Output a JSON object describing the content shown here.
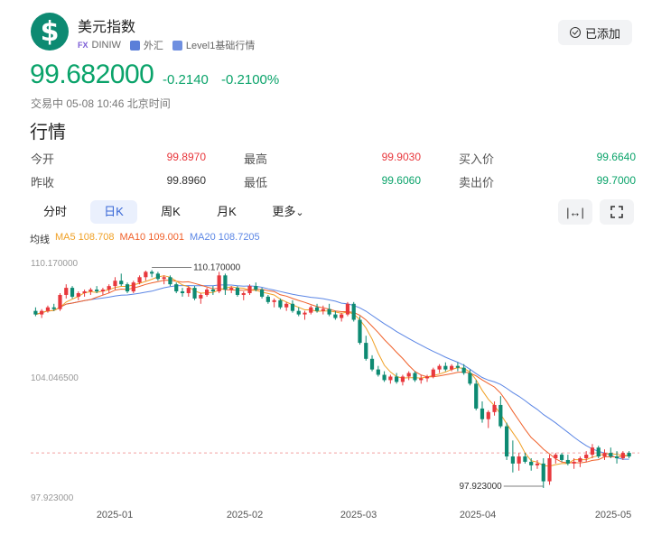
{
  "header": {
    "name": "美元指数",
    "fx_tag": "FX",
    "code": "DINIW",
    "tag_forex": "外汇",
    "tag_level": "Level1基础行情",
    "added_label": "已添加",
    "icon_name": "dollar-icon"
  },
  "price": {
    "last": "99.682000",
    "change": "-0.2140",
    "change_pct": "-0.2100%",
    "status": "交易中 05-08 10:46 北京时间"
  },
  "section_title": "行情",
  "quote": {
    "open_label": "今开",
    "open": "99.8970",
    "high_label": "最高",
    "high": "99.9030",
    "bid_label": "买入价",
    "bid": "99.6640",
    "prev_label": "昨收",
    "prev": "99.8960",
    "low_label": "最低",
    "low": "99.6060",
    "ask_label": "卖出价",
    "ask": "99.7000"
  },
  "tabs": [
    {
      "label": "分时"
    },
    {
      "label": "日K"
    },
    {
      "label": "周K"
    },
    {
      "label": "月K"
    },
    {
      "label": "更多"
    }
  ],
  "tools": {
    "fit_icon": "fit-width-icon",
    "fullscreen_icon": "fullscreen-icon"
  },
  "legend": {
    "title": "均线",
    "ma5": "MA5 108.708",
    "ma10": "MA10 109.001",
    "ma20": "MA20 108.7205"
  },
  "colors": {
    "up": "#e8383d",
    "down": "#0d8a72",
    "ma5": "#f0a025",
    "ma10": "#f0602a",
    "ma20": "#5b86e5",
    "accent": "#0aa36a"
  },
  "chart_data": {
    "type": "candlestick",
    "yaxis_ticks": [
      "110.170000",
      "104.046500",
      "97.923000"
    ],
    "x_labels": [
      "2025-01",
      "2025-02",
      "2025-03",
      "2025-04",
      "2025-05"
    ],
    "ylim": [
      97.923,
      110.17
    ],
    "high_annotation": "110.170000",
    "low_annotation": "97.923000",
    "prev_close": 99.896,
    "ohlc": [
      [
        107.9,
        108.1,
        107.6,
        107.7
      ],
      [
        107.7,
        108.0,
        107.5,
        107.9
      ],
      [
        107.9,
        108.2,
        107.8,
        108.1
      ],
      [
        108.1,
        108.3,
        107.9,
        108.0
      ],
      [
        108.0,
        108.9,
        107.9,
        108.8
      ],
      [
        108.8,
        109.4,
        108.6,
        109.2
      ],
      [
        109.2,
        109.3,
        108.6,
        108.7
      ],
      [
        108.7,
        109.0,
        108.5,
        108.9
      ],
      [
        108.9,
        109.1,
        108.7,
        109.0
      ],
      [
        109.0,
        109.2,
        108.8,
        109.1
      ],
      [
        109.1,
        109.3,
        108.9,
        109.0
      ],
      [
        109.0,
        109.2,
        108.8,
        109.1
      ],
      [
        109.1,
        109.4,
        108.9,
        109.3
      ],
      [
        109.3,
        109.8,
        109.1,
        109.6
      ],
      [
        109.6,
        110.0,
        109.3,
        109.4
      ],
      [
        109.4,
        109.5,
        108.9,
        109.0
      ],
      [
        109.0,
        109.6,
        108.9,
        109.5
      ],
      [
        109.5,
        109.9,
        109.4,
        109.8
      ],
      [
        109.8,
        110.17,
        109.6,
        110.1
      ],
      [
        110.1,
        110.2,
        109.8,
        110.0
      ],
      [
        110.0,
        110.1,
        109.6,
        109.7
      ],
      [
        109.7,
        109.9,
        109.4,
        109.8
      ],
      [
        109.8,
        109.9,
        109.3,
        109.4
      ],
      [
        109.4,
        109.5,
        108.9,
        109.0
      ],
      [
        109.0,
        109.2,
        108.7,
        108.9
      ],
      [
        108.9,
        109.3,
        108.7,
        109.2
      ],
      [
        109.2,
        109.3,
        108.5,
        108.6
      ],
      [
        108.6,
        108.9,
        108.3,
        108.8
      ],
      [
        108.8,
        109.2,
        108.7,
        109.1
      ],
      [
        109.1,
        109.3,
        108.8,
        109.0
      ],
      [
        109.0,
        110.1,
        108.9,
        109.9
      ],
      [
        109.9,
        110.0,
        108.8,
        109.1
      ],
      [
        109.1,
        109.3,
        108.9,
        109.2
      ],
      [
        109.2,
        109.3,
        108.7,
        108.8
      ],
      [
        108.8,
        109.0,
        108.5,
        108.9
      ],
      [
        108.9,
        109.4,
        108.8,
        109.3
      ],
      [
        109.3,
        109.5,
        109.0,
        109.1
      ],
      [
        109.1,
        109.2,
        108.6,
        108.7
      ],
      [
        108.7,
        108.8,
        108.3,
        108.4
      ],
      [
        108.4,
        108.6,
        108.1,
        108.5
      ],
      [
        108.5,
        108.6,
        108.0,
        108.1
      ],
      [
        108.1,
        108.4,
        107.9,
        108.3
      ],
      [
        108.3,
        108.5,
        107.8,
        107.9
      ],
      [
        107.9,
        108.1,
        107.6,
        107.7
      ],
      [
        107.7,
        107.9,
        107.4,
        107.8
      ],
      [
        107.8,
        108.2,
        107.7,
        108.1
      ],
      [
        108.1,
        108.3,
        107.8,
        107.9
      ],
      [
        107.9,
        108.2,
        107.7,
        108.0
      ],
      [
        108.0,
        108.3,
        107.6,
        107.7
      ],
      [
        107.7,
        107.9,
        107.4,
        107.5
      ],
      [
        107.5,
        107.8,
        107.3,
        107.7
      ],
      [
        107.7,
        108.4,
        107.6,
        108.3
      ],
      [
        108.3,
        108.4,
        107.3,
        107.4
      ],
      [
        107.4,
        107.6,
        106.0,
        106.1
      ],
      [
        106.1,
        106.5,
        105.1,
        105.2
      ],
      [
        105.2,
        105.4,
        104.5,
        104.6
      ],
      [
        104.6,
        104.8,
        104.2,
        104.3
      ],
      [
        104.3,
        104.5,
        103.9,
        104.0
      ],
      [
        104.0,
        104.3,
        103.8,
        104.2
      ],
      [
        104.2,
        104.4,
        103.8,
        103.9
      ],
      [
        103.9,
        104.3,
        103.7,
        104.2
      ],
      [
        104.2,
        104.5,
        104.0,
        104.4
      ],
      [
        104.4,
        104.5,
        103.9,
        104.0
      ],
      [
        104.0,
        104.3,
        103.8,
        104.1
      ],
      [
        104.1,
        104.3,
        103.9,
        104.2
      ],
      [
        104.2,
        104.7,
        104.1,
        104.6
      ],
      [
        104.6,
        104.9,
        104.4,
        104.8
      ],
      [
        104.8,
        105.0,
        104.5,
        104.6
      ],
      [
        104.6,
        104.9,
        104.5,
        104.8
      ],
      [
        104.8,
        105.0,
        104.5,
        104.7
      ],
      [
        104.7,
        104.9,
        104.3,
        104.4
      ],
      [
        104.4,
        104.6,
        103.7,
        103.8
      ],
      [
        103.8,
        104.0,
        102.3,
        102.4
      ],
      [
        102.4,
        102.8,
        101.6,
        101.8
      ],
      [
        101.8,
        102.3,
        101.3,
        102.2
      ],
      [
        102.2,
        102.8,
        102.0,
        102.6
      ],
      [
        102.6,
        103.1,
        101.3,
        101.4
      ],
      [
        101.4,
        101.6,
        99.5,
        99.7
      ],
      [
        99.7,
        100.6,
        98.8,
        99.3
      ],
      [
        99.3,
        99.9,
        98.9,
        99.7
      ],
      [
        99.7,
        99.9,
        99.3,
        99.4
      ],
      [
        99.4,
        99.6,
        98.9,
        99.2
      ],
      [
        99.2,
        99.5,
        99.0,
        99.3
      ],
      [
        99.3,
        99.6,
        97.923,
        98.3
      ],
      [
        98.3,
        99.8,
        98.1,
        99.6
      ],
      [
        99.6,
        99.9,
        99.3,
        99.8
      ],
      [
        99.8,
        99.9,
        99.4,
        99.5
      ],
      [
        99.5,
        99.8,
        99.2,
        99.3
      ],
      [
        99.3,
        99.6,
        99.0,
        99.4
      ],
      [
        99.4,
        99.7,
        99.1,
        99.6
      ],
      [
        99.6,
        100.0,
        99.4,
        99.8
      ],
      [
        99.8,
        100.4,
        99.6,
        100.2
      ],
      [
        100.2,
        100.3,
        99.6,
        99.7
      ],
      [
        99.7,
        100.1,
        99.5,
        99.9
      ],
      [
        99.9,
        100.2,
        99.6,
        99.7
      ],
      [
        99.7,
        100.0,
        99.3,
        99.6
      ],
      [
        99.6,
        100.0,
        99.5,
        99.9
      ],
      [
        99.9,
        100.0,
        99.6,
        99.7
      ]
    ]
  }
}
